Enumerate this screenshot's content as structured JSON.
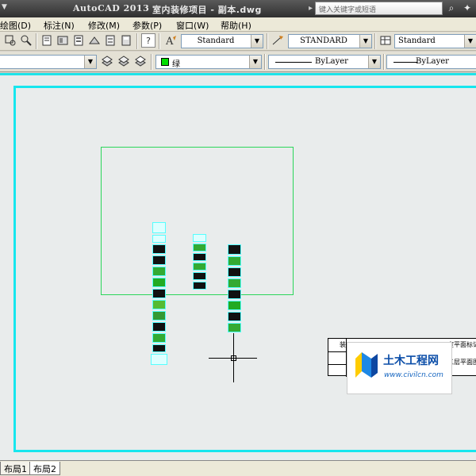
{
  "titlebar": {
    "app_name": "AutoCAD 2013",
    "document": "室内装修项目 - 副本.dwg",
    "search_placeholder": "键入关键字或短语"
  },
  "menu": {
    "items": [
      "绘图(D)",
      "标注(N)",
      "修改(M)",
      "参数(P)",
      "窗口(W)",
      "帮助(H)"
    ]
  },
  "toolbar_styles": {
    "text_style": "Standard",
    "dim_style": "STANDARD",
    "table_style": "Standard"
  },
  "toolbar_properties": {
    "color": "绿",
    "linetype": "ByLayer",
    "lineweight": "ByLayer"
  },
  "drawing": {
    "titleblock_text_1": "装",
    "titleblock_text_2": "室平面标记",
    "titleblock_text_3": "三层平面图"
  },
  "watermark": {
    "name": "土木工程网",
    "url": "www.civilcn.com"
  },
  "tabs": [
    "布局1",
    "布局2"
  ],
  "colors": {
    "paper_border": "#17e6ee",
    "viewport_border": "#2bd65a",
    "canvas_bg": "#e9ecec"
  }
}
